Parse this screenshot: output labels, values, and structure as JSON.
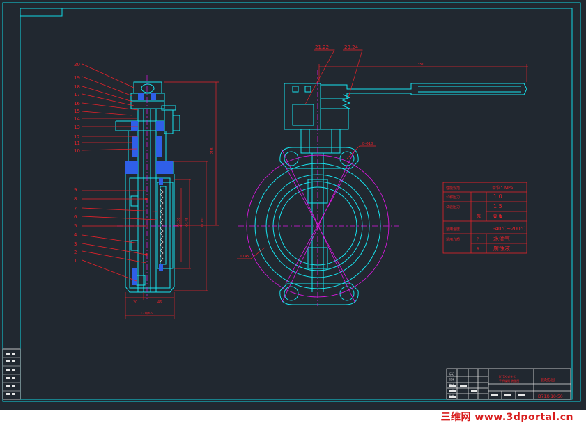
{
  "parts": {
    "left": [
      "20",
      "19",
      "18",
      "17",
      "16",
      "15",
      "14",
      "13",
      "12",
      "11",
      "10",
      "9",
      "8",
      "7",
      "6",
      "5",
      "4",
      "3",
      "2",
      "1"
    ],
    "right_top": [
      "21,22",
      "23,24"
    ]
  },
  "dims": {
    "bottom_a": "20",
    "bottom_b": "46",
    "bottom_c": "170/66",
    "tall_right": "218",
    "handle_len": "350",
    "dn_a": "Φ130",
    "dn_b": "Φ145",
    "dn_c": "Φ160",
    "hole_note": "8-Φ18",
    "pcd_note": "Φ145"
  },
  "spec_table": {
    "header_left": "性能规范",
    "header_right": "单位：MPa",
    "rows": [
      {
        "label": "公称压力",
        "value": "1.0"
      },
      {
        "label": "试验压力",
        "sub": "",
        "value": "1.5"
      },
      {
        "label": "",
        "sub": "壳",
        "value": "1.1"
      },
      {
        "label": "",
        "sub": "气",
        "value": "0.6"
      },
      {
        "label": "适用温度",
        "value": "-40℃~200℃"
      },
      {
        "label": "适用介质",
        "sub": "P",
        "value": "水油气"
      },
      {
        "label": "",
        "sub": "R",
        "value": "腐蚀液"
      }
    ]
  },
  "title_block": {
    "company_a": "D71X 对夹式",
    "company_b": "手柄蝶阀 装配图",
    "drawing_name": "装配总图",
    "drawing_code": "D71X-10-50",
    "row_labels": [
      "标记",
      "设计",
      "审核",
      "工艺",
      "批准"
    ]
  },
  "watermark": "三维网 www.3dportal.cn",
  "colors": {
    "bg": "#212830",
    "frame": "#11d8e4",
    "part": "#18e3ef",
    "section": "#2f5fe8",
    "annot": "#e8222a",
    "center": "#e018e6",
    "white": "#e6e6e6"
  }
}
